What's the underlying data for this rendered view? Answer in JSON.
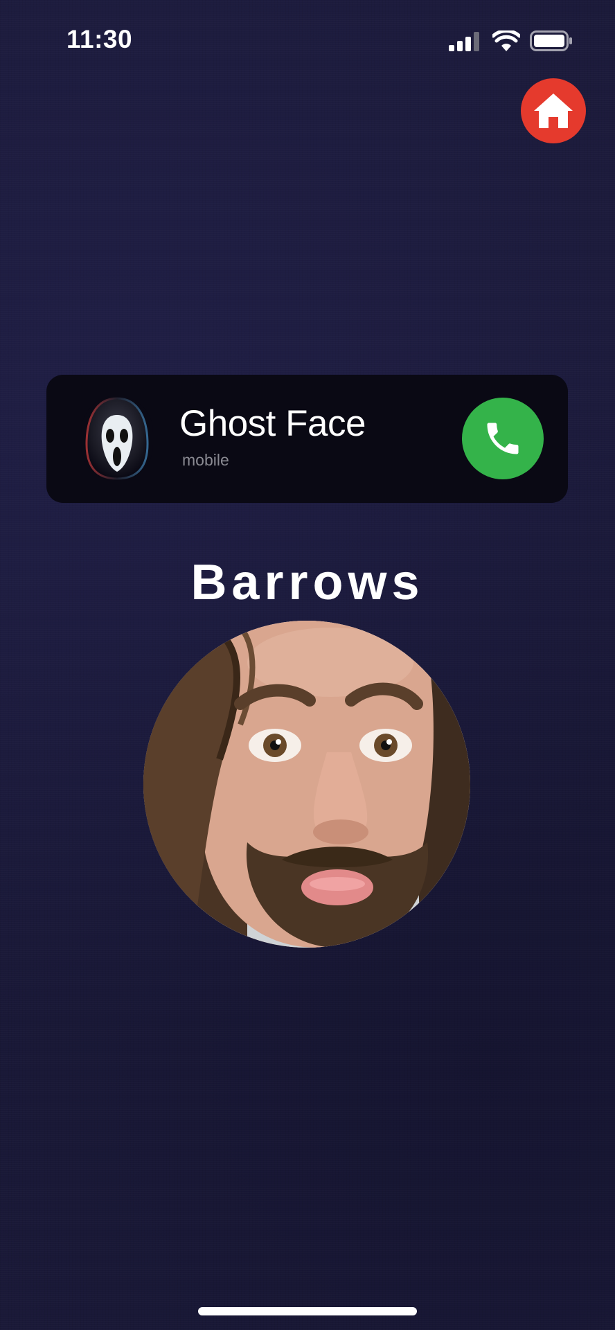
{
  "status_bar": {
    "time": "11:30",
    "icons": [
      "cellular-signal-icon",
      "wifi-icon",
      "battery-icon"
    ]
  },
  "home_button": {
    "icon": "house-icon",
    "color": "#e53a2d"
  },
  "incoming_call": {
    "caller_name": "Ghost Face",
    "caller_label": "mobile",
    "avatar": "ghostface-mask-avatar",
    "answer_icon": "phone-icon",
    "answer_color": "#34b34a"
  },
  "person": {
    "name": "Barrows",
    "photo": "person-face-photo"
  },
  "colors": {
    "background": "#1b1a3a",
    "banner": "#0a0914"
  }
}
